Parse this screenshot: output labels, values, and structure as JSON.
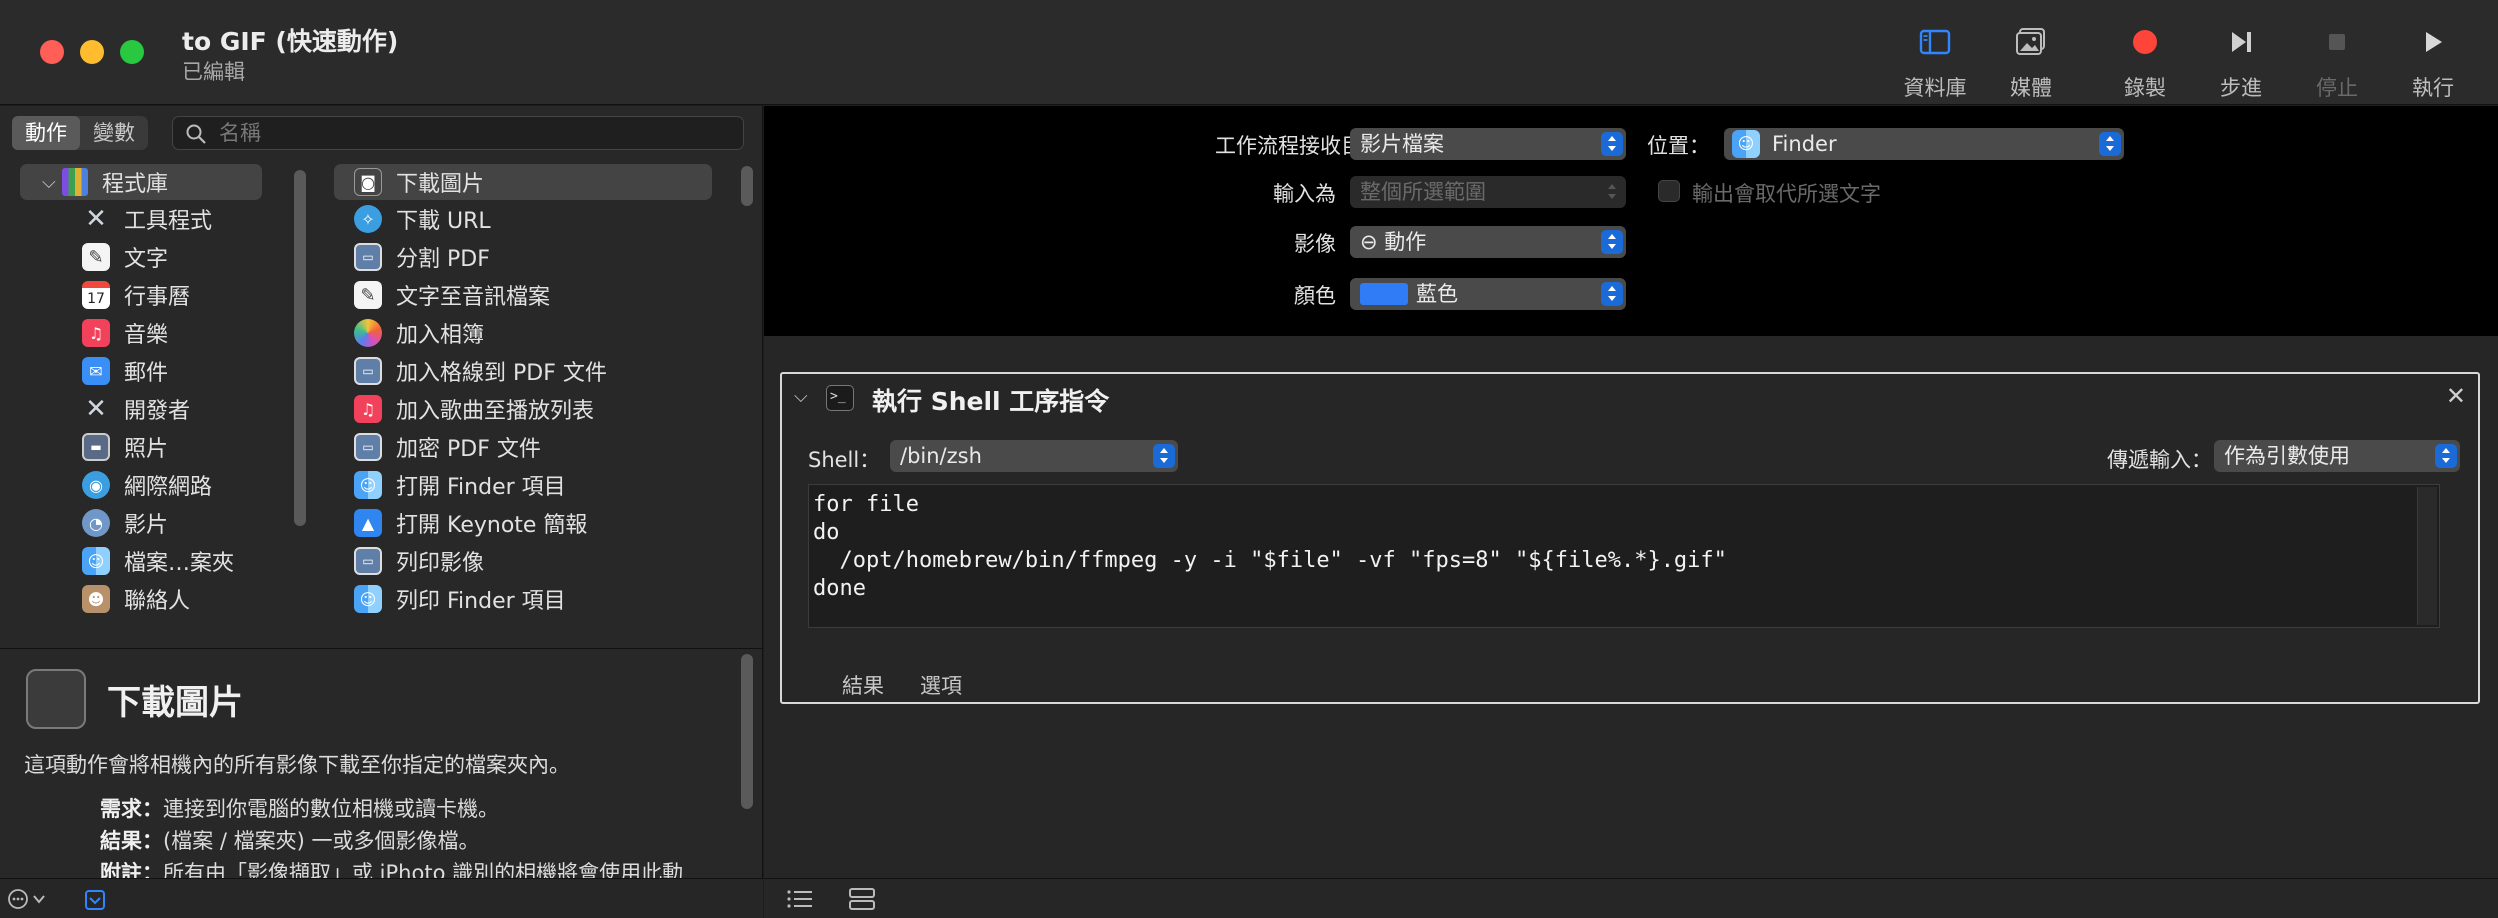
{
  "window": {
    "title": "to GIF (快速動作)",
    "subtitle": "已編輯"
  },
  "toolbar": {
    "library": "資料庫",
    "media": "媒體",
    "record": "錄製",
    "step": "步進",
    "stop": "停止",
    "run": "執行"
  },
  "left": {
    "tabs": [
      "動作",
      "變數"
    ],
    "search_placeholder": "名稱",
    "library_root": "程式庫",
    "library_items": [
      {
        "label": "工具程式",
        "icon": "tools-icon"
      },
      {
        "label": "文字",
        "icon": "text-icon"
      },
      {
        "label": "行事曆",
        "icon": "calendar-icon",
        "day": "17"
      },
      {
        "label": "音樂",
        "icon": "music-icon"
      },
      {
        "label": "郵件",
        "icon": "mail-icon"
      },
      {
        "label": "開發者",
        "icon": "developer-icon"
      },
      {
        "label": "照片",
        "icon": "photos-icon"
      },
      {
        "label": "網際網路",
        "icon": "internet-icon"
      },
      {
        "label": "影片",
        "icon": "movies-icon"
      },
      {
        "label": "檔案…案夾",
        "icon": "finder-icon"
      },
      {
        "label": "聯絡人",
        "icon": "contacts-icon"
      }
    ],
    "actions": [
      {
        "label": "下載圖片",
        "icon": "camera-icon"
      },
      {
        "label": "下載 URL",
        "icon": "safari-icon"
      },
      {
        "label": "分割 PDF",
        "icon": "preview-icon"
      },
      {
        "label": "文字至音訊檔案",
        "icon": "textedit-icon"
      },
      {
        "label": "加入相簿",
        "icon": "photos-icon"
      },
      {
        "label": "加入格線到 PDF 文件",
        "icon": "preview-icon"
      },
      {
        "label": "加入歌曲至播放列表",
        "icon": "music-icon"
      },
      {
        "label": "加密 PDF 文件",
        "icon": "preview-icon"
      },
      {
        "label": "打開 Finder 項目",
        "icon": "finder-icon"
      },
      {
        "label": "打開 Keynote 簡報",
        "icon": "keynote-icon"
      },
      {
        "label": "列印影像",
        "icon": "preview-icon"
      },
      {
        "label": "列印 Finder 項目",
        "icon": "finder-icon"
      }
    ],
    "description": {
      "title": "下載圖片",
      "text": "這項動作會將相機內的所有影像下載至你指定的檔案夾內。",
      "requires_label": "需求：",
      "requires": "連接到你電腦的數位相機或讀卡機。",
      "result_label": "結果：",
      "result": "(檔案 / 檔案夾) 一或多個影像檔。",
      "note_label": "附註：",
      "note": "所有由「影像擷取」或 iPhoto 識別的相機將會使用此動"
    }
  },
  "workflow": {
    "receives_label": "工作流程接收目前的",
    "receives_value": "影片檔案",
    "location_label": "位置：",
    "location_value": "Finder",
    "input_label": "輸入為",
    "input_value": "整個所選範圍",
    "replace_label": "輸出會取代所選文字",
    "image_label": "影像",
    "image_value": "⊖ 動作",
    "color_label": "顏色",
    "color_value": "藍色",
    "color_swatch": "#2f7cf6"
  },
  "action": {
    "title": "執行 Shell 工序指令",
    "shell_label": "Shell：",
    "shell_value": "/bin/zsh",
    "pass_label": "傳遞輸入：",
    "pass_value": "作為引數使用",
    "code": "for file\ndo\n  /opt/homebrew/bin/ffmpeg -y -i \"$file\" -vf \"fps=8\" \"${file%.*}.gif\"\ndone",
    "tabs": [
      "結果",
      "選項"
    ]
  },
  "colors": {
    "accent": "#1a6bd8",
    "record_red": "#ff453a"
  }
}
